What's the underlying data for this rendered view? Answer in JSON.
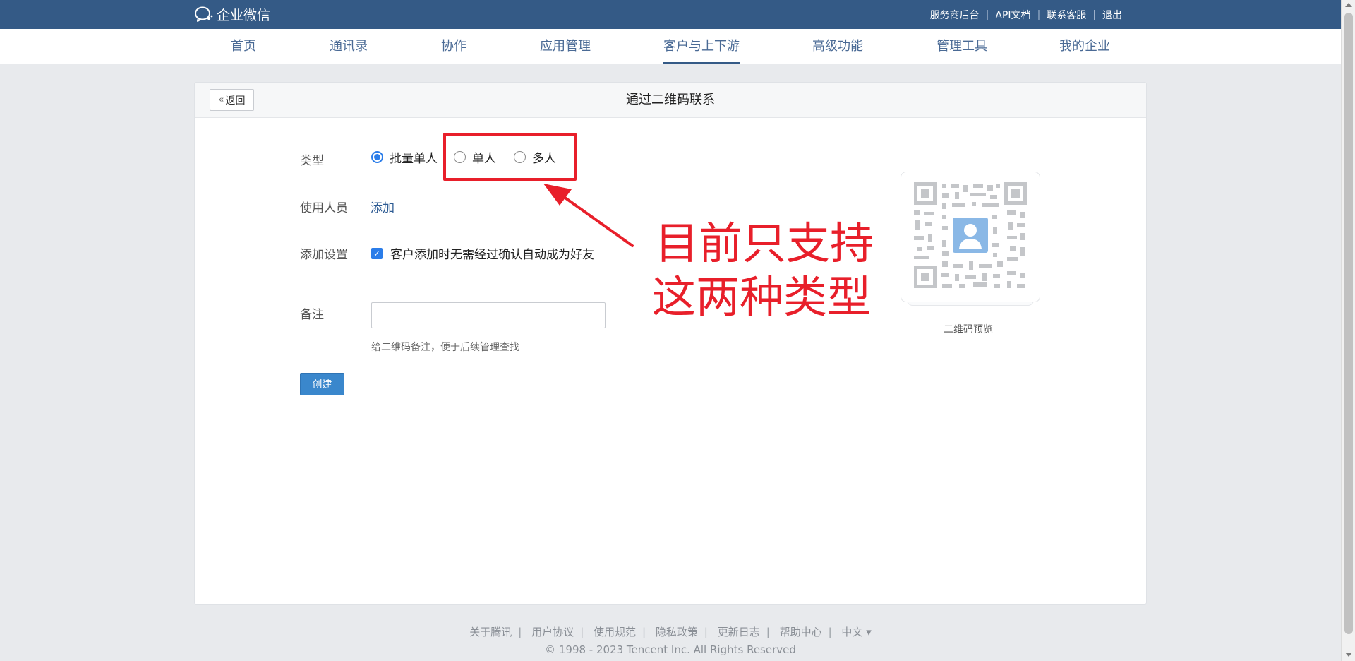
{
  "brand": {
    "name": "企业微信",
    "icon": "wecom-logo-icon"
  },
  "top_links": [
    "服务商后台",
    "API文档",
    "联系客服",
    "退出"
  ],
  "nav": {
    "items": [
      "首页",
      "通讯录",
      "协作",
      "应用管理",
      "客户与上下游",
      "高级功能",
      "管理工具",
      "我的企业"
    ],
    "active_index": 4
  },
  "page": {
    "back_label": "返回",
    "title": "通过二维码联系"
  },
  "form": {
    "type_label": "类型",
    "type_options": [
      "批量单人",
      "单人",
      "多人"
    ],
    "type_selected": "批量单人",
    "users_label": "使用人员",
    "users_add": "添加",
    "settings_label": "添加设置",
    "settings_checkbox": "客户添加时无需经过确认自动成为好友",
    "settings_checked": true,
    "note_label": "备注",
    "note_value": "",
    "note_hint": "给二维码备注，便于后续管理查找",
    "create_button": "创建"
  },
  "annotation": {
    "line1": "目前只支持",
    "line2": "这两种类型",
    "color": "#e81f2a"
  },
  "qr_preview": {
    "caption": "二维码预览"
  },
  "footer": {
    "links": [
      "关于腾讯",
      "用户协议",
      "使用规范",
      "隐私政策",
      "更新日志",
      "帮助中心",
      "中文 ▾"
    ],
    "copyright": "© 1998 - 2023 Tencent Inc. All Rights Reserved"
  },
  "colors": {
    "topbar": "#345a86",
    "primary_button": "#3a87cc",
    "link": "#2d5b93"
  }
}
